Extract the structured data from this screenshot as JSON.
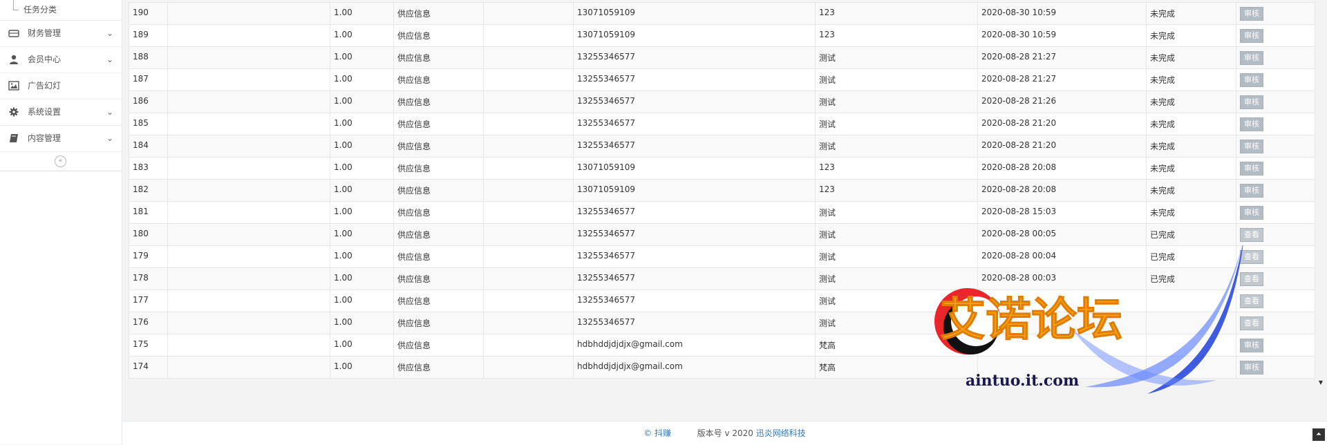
{
  "sidebar": {
    "sub_item": "任务分类",
    "items": [
      {
        "label": "财务管理",
        "icon": "wallet-icon",
        "has_children": true
      },
      {
        "label": "会员中心",
        "icon": "user-icon",
        "has_children": true
      },
      {
        "label": "广告幻灯",
        "icon": "image-icon",
        "has_children": false
      },
      {
        "label": "系统设置",
        "icon": "gear-icon",
        "has_children": true
      },
      {
        "label": "内容管理",
        "icon": "book-icon",
        "has_children": true
      }
    ],
    "collapse_glyph": "«"
  },
  "table": {
    "rows": [
      [
        "190",
        "",
        "1.00",
        "供应信息",
        "",
        "13071059109",
        "123",
        "2020-08-30 10:59",
        "未完成",
        "审核"
      ],
      [
        "189",
        "",
        "1.00",
        "供应信息",
        "",
        "13071059109",
        "123",
        "2020-08-30 10:59",
        "未完成",
        "审核"
      ],
      [
        "188",
        "",
        "1.00",
        "供应信息",
        "",
        "13255346577",
        "测试",
        "2020-08-28 21:27",
        "未完成",
        "审核"
      ],
      [
        "187",
        "",
        "1.00",
        "供应信息",
        "",
        "13255346577",
        "测试",
        "2020-08-28 21:27",
        "未完成",
        "审核"
      ],
      [
        "186",
        "",
        "1.00",
        "供应信息",
        "",
        "13255346577",
        "测试",
        "2020-08-28 21:26",
        "未完成",
        "审核"
      ],
      [
        "185",
        "",
        "1.00",
        "供应信息",
        "",
        "13255346577",
        "测试",
        "2020-08-28 21:20",
        "未完成",
        "审核"
      ],
      [
        "184",
        "",
        "1.00",
        "供应信息",
        "",
        "13255346577",
        "测试",
        "2020-08-28 21:20",
        "未完成",
        "审核"
      ],
      [
        "183",
        "",
        "1.00",
        "供应信息",
        "",
        "13071059109",
        "123",
        "2020-08-28 20:08",
        "未完成",
        "审核"
      ],
      [
        "182",
        "",
        "1.00",
        "供应信息",
        "",
        "13071059109",
        "123",
        "2020-08-28 20:08",
        "未完成",
        "审核"
      ],
      [
        "181",
        "",
        "1.00",
        "供应信息",
        "",
        "13255346577",
        "测试",
        "2020-08-28 15:03",
        "未完成",
        "审核"
      ],
      [
        "180",
        "",
        "1.00",
        "供应信息",
        "",
        "13255346577",
        "测试",
        "2020-08-28 00:05",
        "已完成",
        "查看"
      ],
      [
        "179",
        "",
        "1.00",
        "供应信息",
        "",
        "13255346577",
        "测试",
        "2020-08-28 00:04",
        "已完成",
        "查看"
      ],
      [
        "178",
        "",
        "1.00",
        "供应信息",
        "",
        "13255346577",
        "测试",
        "2020-08-28 00:03",
        "已完成",
        "查看"
      ],
      [
        "177",
        "",
        "1.00",
        "供应信息",
        "",
        "13255346577",
        "测试",
        "",
        "",
        "查看"
      ],
      [
        "176",
        "",
        "1.00",
        "供应信息",
        "",
        "13255346577",
        "测试",
        "",
        "",
        "查看"
      ],
      [
        "175",
        "",
        "1.00",
        "供应信息",
        "",
        "hdbhddjdjdjx@gmail.com",
        "梵高",
        "",
        "",
        "审核"
      ],
      [
        "174",
        "",
        "1.00",
        "供应信息",
        "",
        "hdbhddjdjdjx@gmail.com",
        "梵高",
        "",
        "",
        "审核"
      ]
    ]
  },
  "footer": {
    "copyright": "© 抖赚",
    "version_label": "版本号 v 2020",
    "company": "迅炎网络科技"
  },
  "watermark": {
    "title": "艾诺论坛",
    "url": "aintuo.it.com"
  },
  "colors": {
    "button": "#b3bcc3",
    "link": "#337ab7",
    "watermark_orange": "#f7a21b",
    "watermark_red": "#e8262b",
    "watermark_blue": "#1f3fd9"
  }
}
